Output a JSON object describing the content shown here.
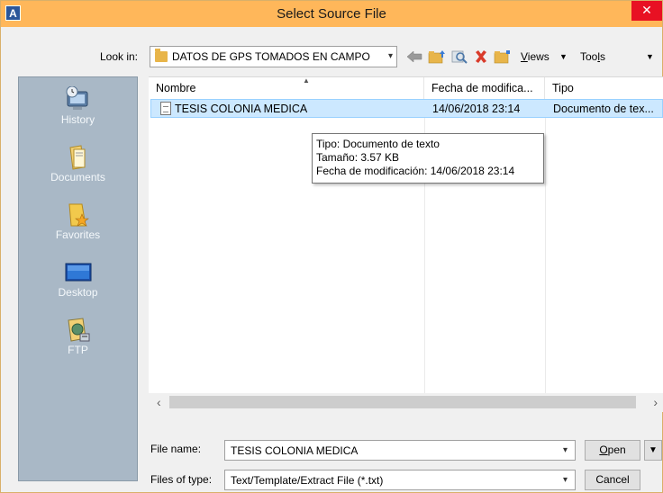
{
  "window": {
    "title": "Select Source File",
    "close_glyph": "✕",
    "app_icon_letter": "A"
  },
  "toolbar": {
    "look_in_label": "Look in:",
    "look_in_value": "DATOS DE GPS TOMADOS EN CAMPO",
    "views_label_u": "V",
    "views_label_rest": "iews",
    "tools_label_a": "Too",
    "tools_label_u": "l",
    "tools_label_b": "s",
    "icons": [
      "back-arrow-icon",
      "up-folder-icon",
      "search-web-icon",
      "delete-icon",
      "new-folder-icon"
    ]
  },
  "places": [
    {
      "label": "History",
      "icon": "history-icon"
    },
    {
      "label": "Documents",
      "icon": "documents-icon"
    },
    {
      "label": "Favorites",
      "icon": "favorites-icon"
    },
    {
      "label": "Desktop",
      "icon": "desktop-icon"
    },
    {
      "label": "FTP",
      "icon": "ftp-icon"
    }
  ],
  "filelist": {
    "columns": [
      "Nombre",
      "Fecha de modifica...",
      "Tipo"
    ],
    "rows": [
      {
        "name": "TESIS COLONIA MEDICA",
        "date": "14/06/2018 23:14",
        "type": "Documento de tex..."
      }
    ],
    "tooltip": {
      "line1": "Tipo: Documento de texto",
      "line2": "Tamaño: 3.57 KB",
      "line3": "Fecha de modificación: 14/06/2018 23:14"
    }
  },
  "form": {
    "file_name_label": "File name:",
    "file_name_value": "TESIS COLONIA MEDICA",
    "file_type_label": "Files of type:",
    "file_type_value": "Text/Template/Extract File (*.txt)",
    "open_label_u": "O",
    "open_label_rest": "pen",
    "cancel_label": "Cancel"
  },
  "colors": {
    "titlebar": "#ffb75a",
    "close": "#e81123",
    "places_bg": "#a9b8c6",
    "selection": "#cce8ff"
  }
}
